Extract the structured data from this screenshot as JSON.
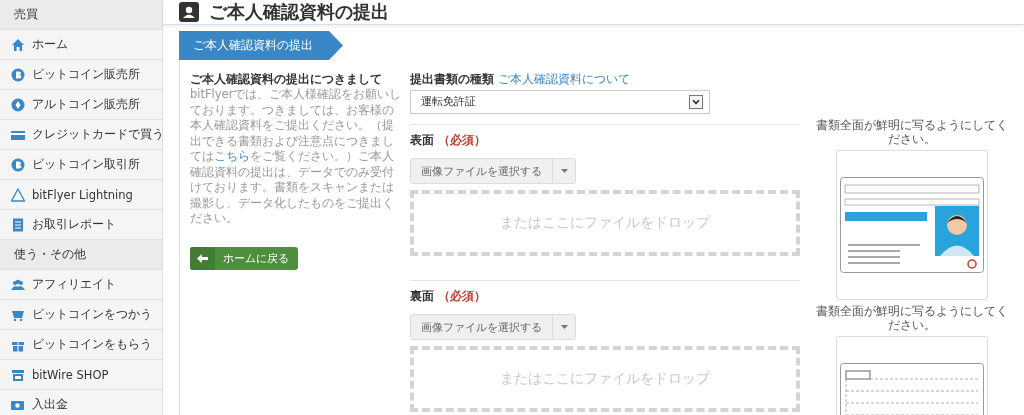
{
  "sidebar": {
    "sections": [
      {
        "title": "売買",
        "items": [
          {
            "label": "ホーム"
          },
          {
            "label": "ビットコイン販売所"
          },
          {
            "label": "アルトコイン販売所"
          },
          {
            "label": "クレジットカードで買う"
          },
          {
            "label": "ビットコイン取引所"
          },
          {
            "label": "bitFlyer Lightning"
          },
          {
            "label": "お取引レポート"
          }
        ]
      },
      {
        "title": "使う・その他",
        "items": [
          {
            "label": "アフィリエイト"
          },
          {
            "label": "ビットコインをつかう"
          },
          {
            "label": "ビットコインをもらう"
          },
          {
            "label": "bitWire SHOP"
          },
          {
            "label": "入出金"
          }
        ]
      }
    ]
  },
  "page": {
    "title": "ご本人確認資料の提出",
    "breadcrumb": "ご本人確認資料の提出"
  },
  "intro": {
    "heading": "ご本人確認資料の提出につきまして",
    "text_before_link": "bitFlyerでは、ご本人様確認をお願いしております。つきましては、お客様の本人確認資料をご提出ください。（提出できる書類および注意点につきましては",
    "link": "こちら",
    "text_after_link": "をご覧ください。）ご本人確認資料の提出は、データでのみ受付けております。書類をスキャンまたは撮影し、データ化したものをご提出ください。",
    "back_button": "ホームに戻る"
  },
  "document_type": {
    "label": "提出書類の種類",
    "link": "ご本人確認資料について",
    "value": "運転免許証"
  },
  "uploads": [
    {
      "side": "表面",
      "required": "（必須）",
      "button": "画像ファイルを選択する",
      "drop": "またはここにファイルをドロップ",
      "hint": "書類全面が鮮明に写るようにしてください。",
      "kind": "front"
    },
    {
      "side": "裏面",
      "required": "（必須）",
      "button": "画像ファイルを選択する",
      "drop": "またはここにファイルをドロップ",
      "hint": "書類全面が鮮明に写るようにしてください。",
      "kind": "back"
    }
  ]
}
